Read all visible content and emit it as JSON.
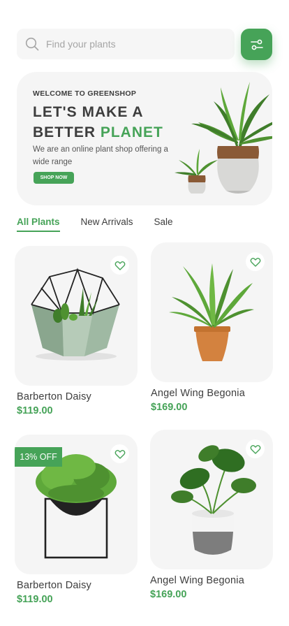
{
  "search": {
    "placeholder": "Find your plants"
  },
  "banner": {
    "welcome": "WELCOME TO GREENSHOP",
    "headline_line1": "LET'S MAKE A",
    "headline_line2_a": "BETTER",
    "headline_line2_b": "PLANET",
    "description": "We are an online plant shop offering a wide range",
    "cta": "SHOP NOW"
  },
  "tabs": [
    {
      "label": "All Plants",
      "active": true
    },
    {
      "label": "New Arrivals",
      "active": false
    },
    {
      "label": "Sale",
      "active": false
    }
  ],
  "products": [
    {
      "name": "Barberton Daisy",
      "price": "$119.00",
      "badge": ""
    },
    {
      "name": "Angel Wing Begonia",
      "price": "$169.00",
      "badge": ""
    },
    {
      "name": "Barberton Daisy",
      "price": "$119.00",
      "badge": "13% OFF"
    },
    {
      "name": "Angel Wing Begonia",
      "price": "$169.00",
      "badge": ""
    }
  ],
  "colors": {
    "accent": "#46a358",
    "text": "#3d3d3d",
    "card_bg": "#f5f5f5"
  },
  "icons": {
    "search": "search-icon",
    "filter": "sliders-icon",
    "favorite": "heart-icon"
  }
}
